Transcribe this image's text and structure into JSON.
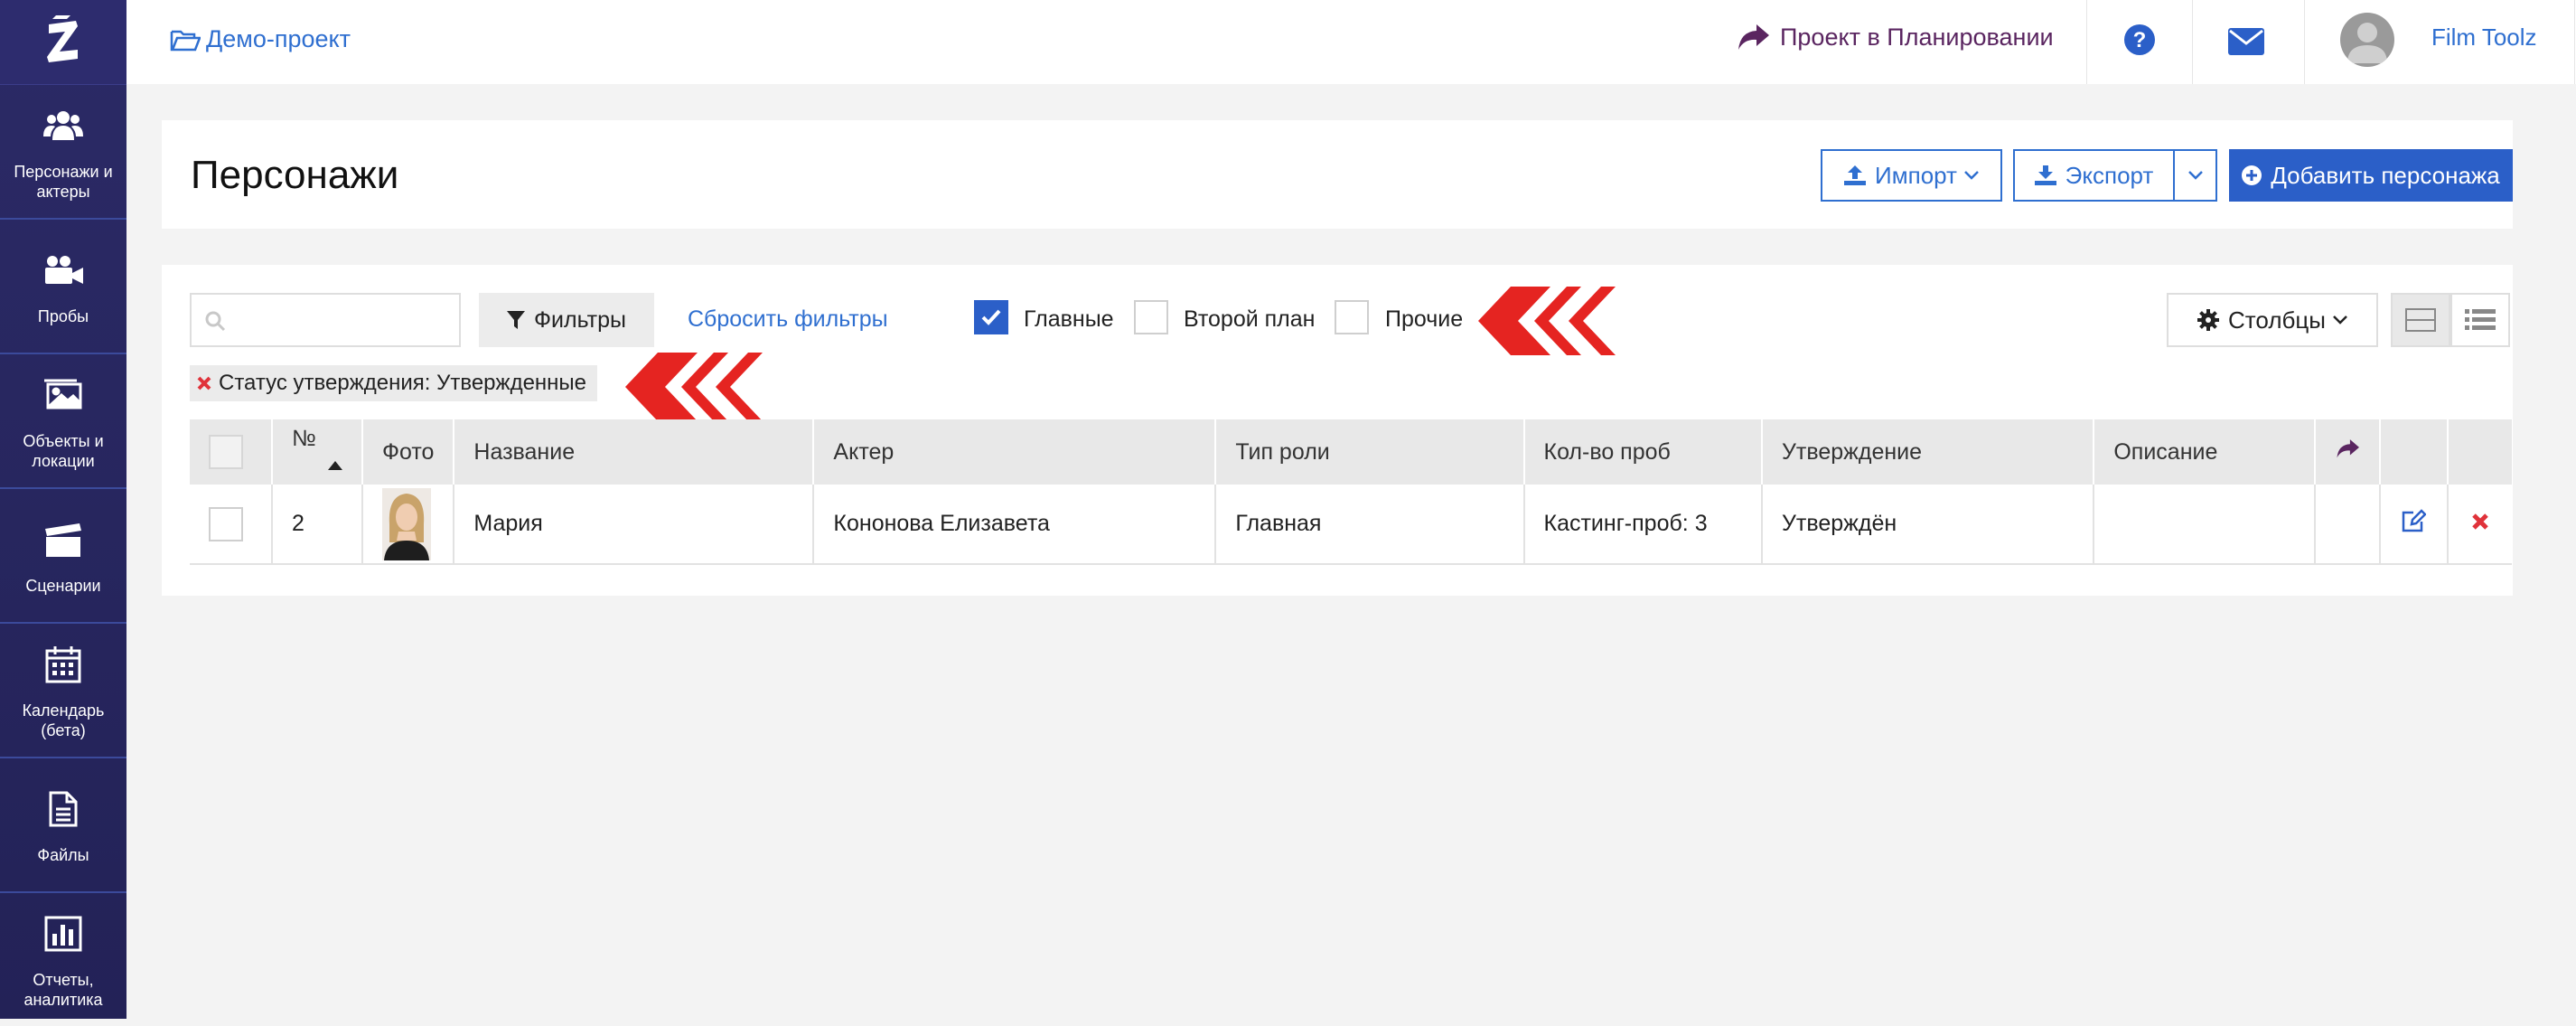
{
  "sidebar": {
    "items": [
      {
        "label": "Персонажи и актеры",
        "icon": "users-icon"
      },
      {
        "label": "Пробы",
        "icon": "video-camera-icon"
      },
      {
        "label": "Объекты и локации",
        "icon": "image-icon"
      },
      {
        "label": "Сценарии",
        "icon": "clapperboard-icon"
      },
      {
        "label": "Календарь (бета)",
        "icon": "calendar-icon"
      },
      {
        "label": "Файлы",
        "icon": "file-icon"
      },
      {
        "label": "Отчеты, аналитика",
        "icon": "bar-chart-icon"
      }
    ]
  },
  "topbar": {
    "project_name": "Демо-проект",
    "project_status": "Проект в Планировании",
    "user_name": "Film Toolz"
  },
  "header": {
    "title": "Персонажи",
    "import_label": "Импорт",
    "export_label": "Экспорт",
    "add_label": "Добавить персонажа"
  },
  "toolbar": {
    "search_placeholder": "",
    "filters_label": "Фильтры",
    "reset_filters_label": "Сбросить фильтры",
    "role_filters": [
      {
        "label": "Главные",
        "checked": true
      },
      {
        "label": "Второй план",
        "checked": false
      },
      {
        "label": "Прочие",
        "checked": false
      }
    ],
    "columns_label": "Столбцы",
    "active_filter_tag": "Статус утверждения:  Утвержденные"
  },
  "table": {
    "columns": [
      "№",
      "Фото",
      "Название",
      "Актер",
      "Тип роли",
      "Кол-во проб",
      "Утверждение",
      "Описание"
    ],
    "rows": [
      {
        "number": "2",
        "name": "Мария",
        "actor": "Кононова Елизавета",
        "role_type": "Главная",
        "tests": "Кастинг-проб: 3",
        "approval": "Утверждён",
        "description": ""
      }
    ]
  },
  "colors": {
    "sidebar": "#2b2a66",
    "accent": "#2b5fc8",
    "link": "#2f6fd0",
    "status": "#5a2560",
    "delete": "#e0323a",
    "annotation": "#e52421"
  }
}
